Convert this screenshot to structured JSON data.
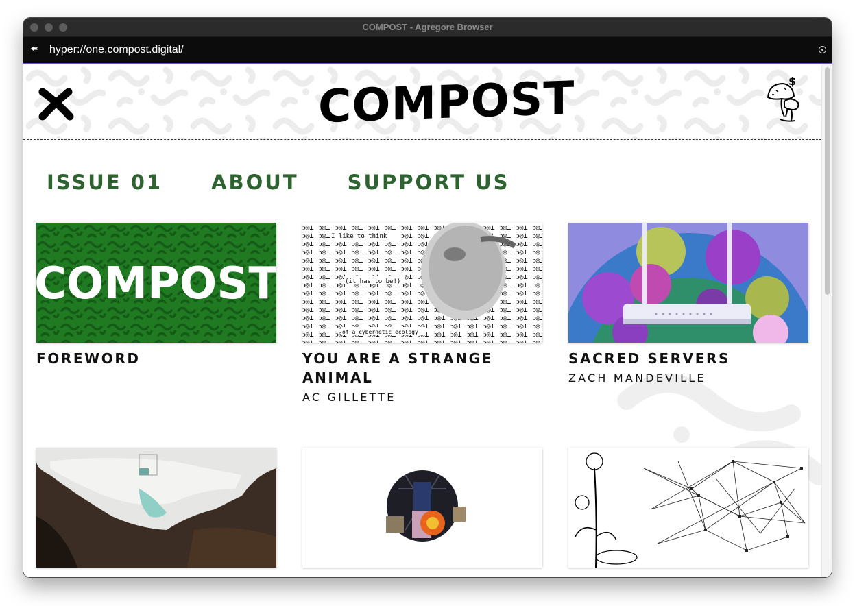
{
  "window": {
    "title": "COMPOST - Agregore Browser"
  },
  "urlbar": {
    "url": "hyper://one.compost.digital/"
  },
  "header": {
    "logo_text": "COMPOST"
  },
  "nav": [
    {
      "label": "ISSUE 01"
    },
    {
      "label": "ABOUT"
    },
    {
      "label": "SUPPORT US"
    }
  ],
  "articles": [
    {
      "title": "FOREWORD",
      "author": "",
      "thumb_text": "COMPOST",
      "thumb_icon": "compost-logo-on-green"
    },
    {
      "title": "YOU ARE A STRANGE ANIMAL",
      "author": "AC GILLETTE",
      "thumb_text_1": "I like to think",
      "thumb_text_2": "(it has to be!)",
      "thumb_text_3": "of a cybernetic ecology",
      "thumb_icon": "glyph-pattern-with-face"
    },
    {
      "title": "SACRED SERVERS",
      "author": "ZACH MANDEVILLE",
      "thumb_icon": "router-with-flowers"
    },
    {
      "title": "",
      "author": "",
      "thumb_icon": "satellite-salt-flat"
    },
    {
      "title": "",
      "author": "",
      "thumb_icon": "collage-circle"
    },
    {
      "title": "",
      "author": "",
      "thumb_icon": "dandelion-network"
    }
  ],
  "colors": {
    "nav_green": "#2f6231",
    "compost_green": "#1f7a22",
    "url_bar_accent": "#6b4bd0"
  }
}
